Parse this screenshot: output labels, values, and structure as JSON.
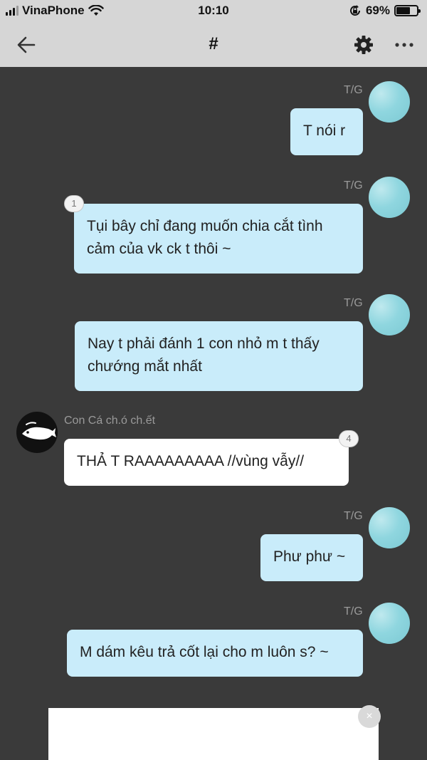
{
  "status_bar": {
    "carrier": "VinaPhone",
    "time": "10:10",
    "battery_percent": "69%",
    "battery_level": 0.69,
    "icons": [
      "signal-icon",
      "wifi-icon",
      "rotation-lock-icon",
      "battery-icon"
    ]
  },
  "nav": {
    "title": "#",
    "icons": [
      "back-arrow-icon",
      "gear-icon",
      "more-icon"
    ]
  },
  "messages": [
    {
      "sender": "T/G",
      "text": "T nói r",
      "side": "right"
    },
    {
      "sender": "T/G",
      "text": "Tụi bây chỉ đang muốn chia cắt tình cảm của vk ck t thôi ~",
      "side": "right",
      "badge": "1"
    },
    {
      "sender": "T/G",
      "text": "Nay t phải đánh 1 con nhỏ m t thấy chướng mắt nhất",
      "side": "right"
    },
    {
      "sender": "Con Cá ch.ó ch.ết",
      "text": "THẢ T RAAAAAAAAA //vùng vẫy//",
      "side": "left",
      "badge": "4"
    },
    {
      "sender": "T/G",
      "text": "Phư phư ~",
      "side": "right"
    },
    {
      "sender": "T/G",
      "text": "M dám kêu trả cốt lại cho m luôn s? ~",
      "side": "right"
    }
  ],
  "ad": {
    "close_label": "×"
  },
  "colors": {
    "bar_bg": "#d6d6d6",
    "chat_bg": "#3a3a3a",
    "my_bubble": "#c9ecfa",
    "other_bubble": "#ffffff"
  }
}
